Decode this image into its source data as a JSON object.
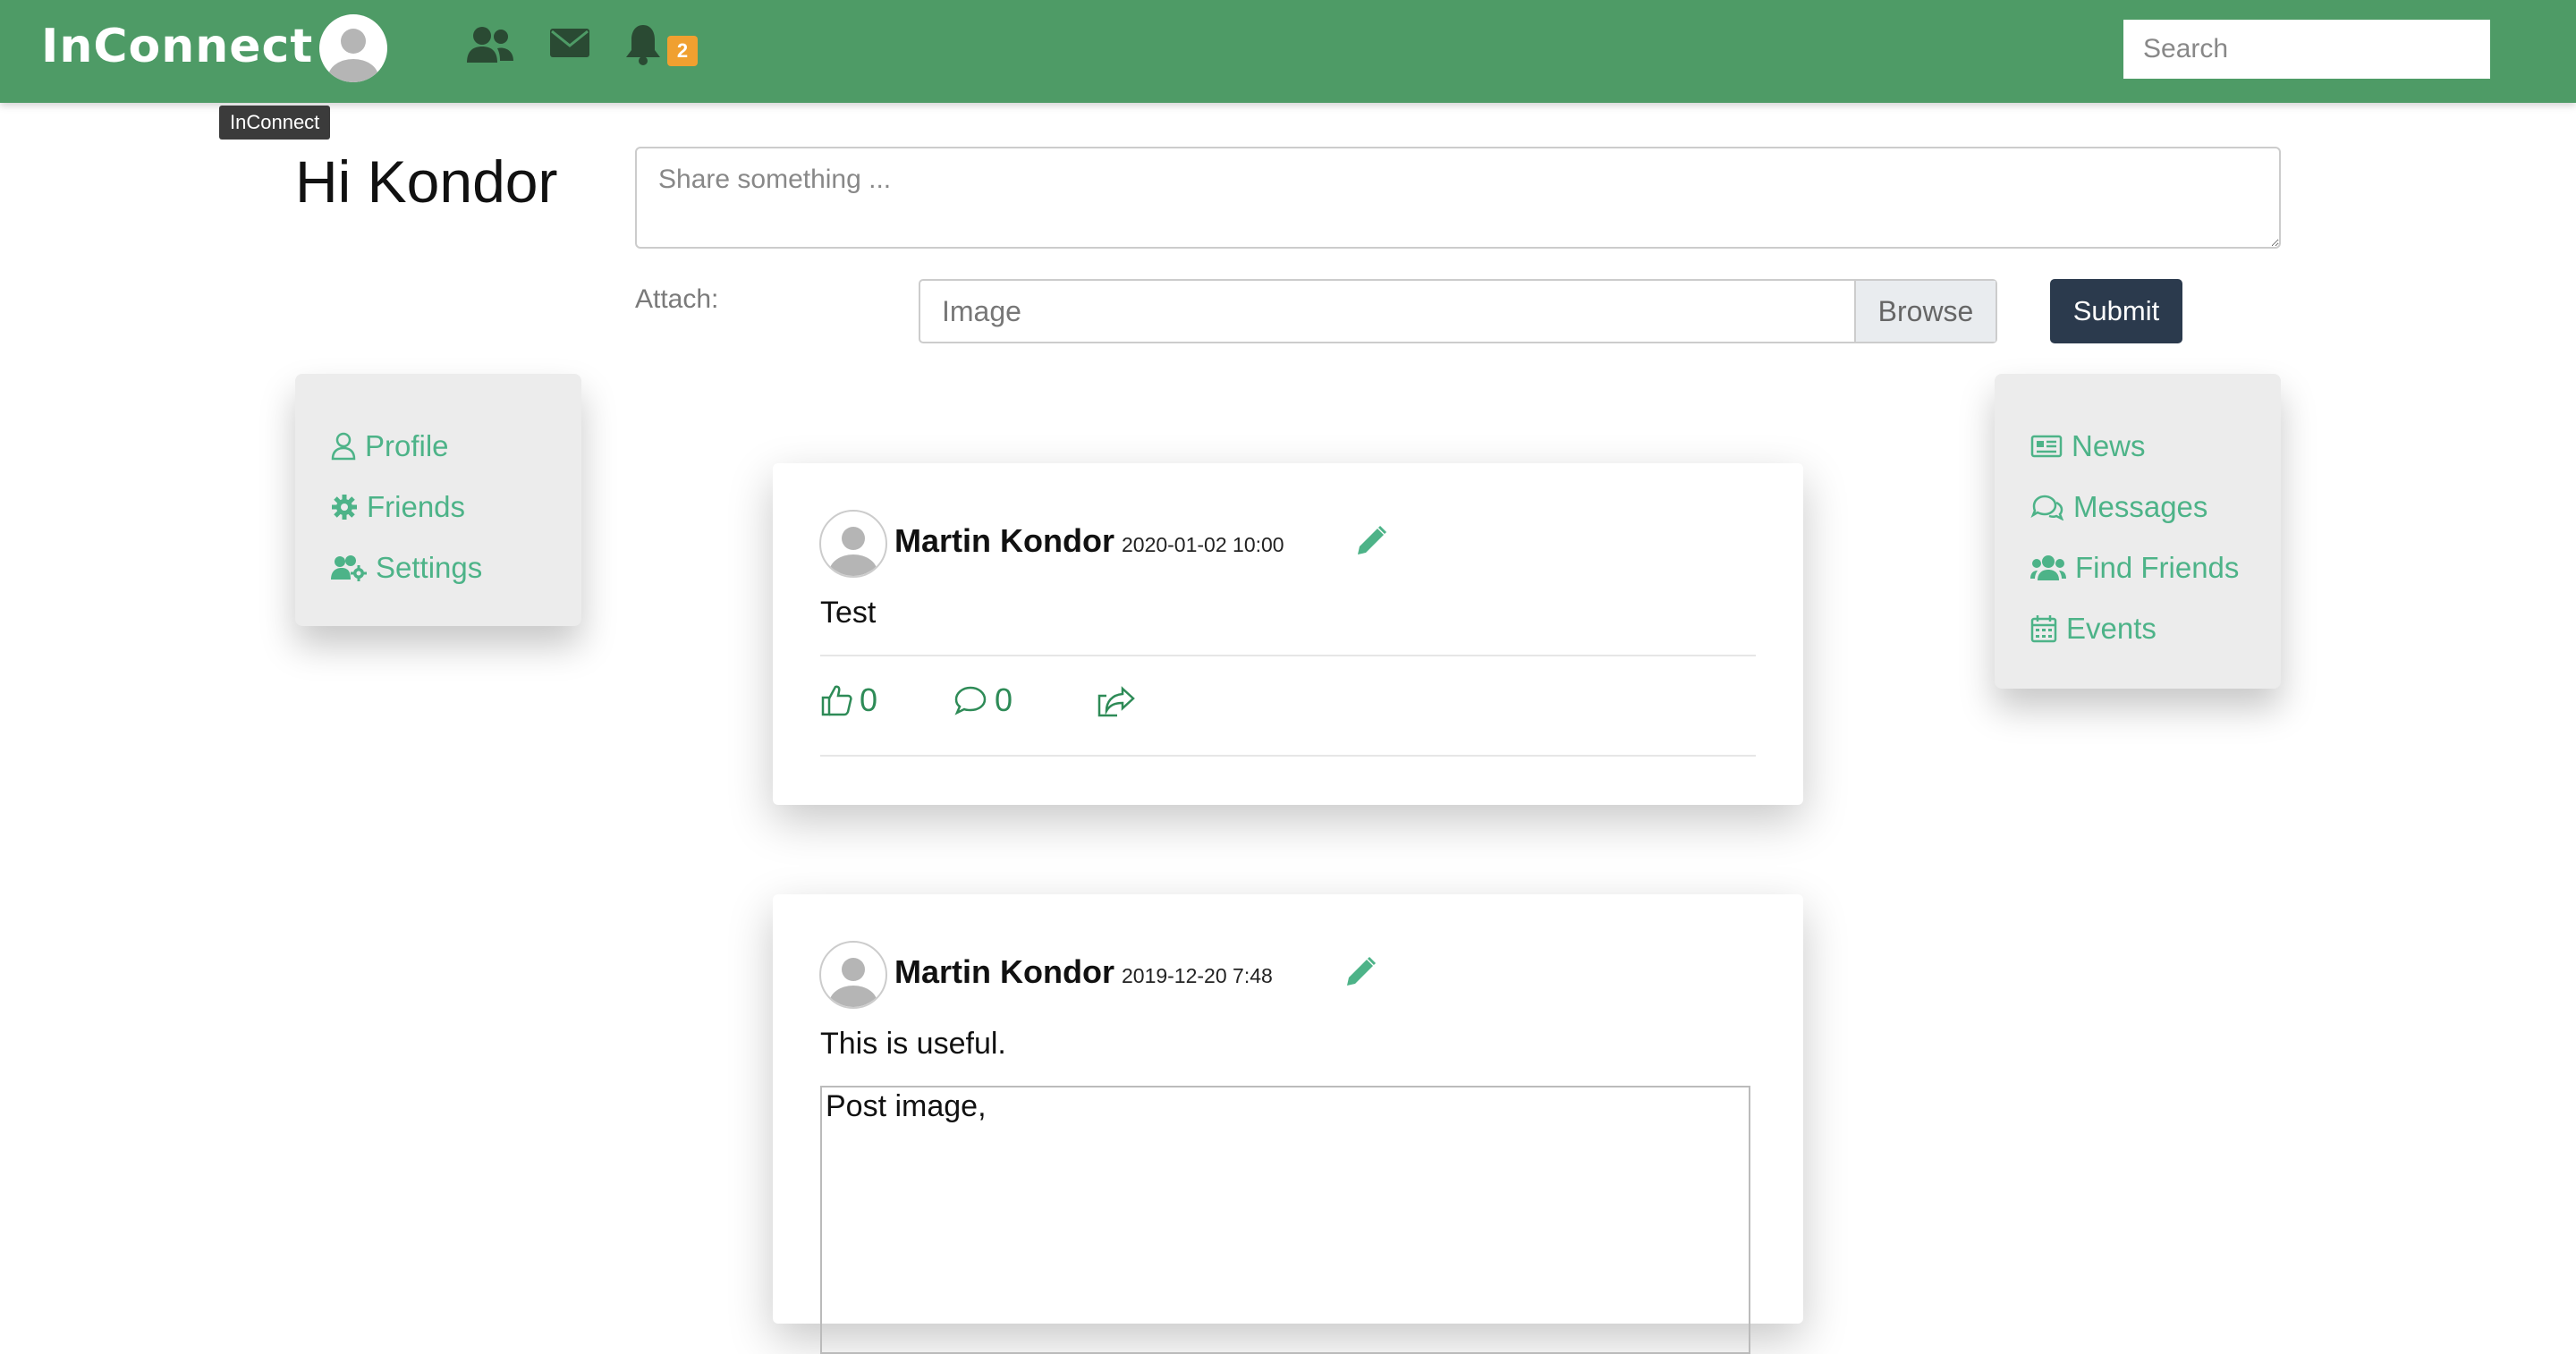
{
  "app": {
    "brand": "InConnect",
    "tooltip": "InConnect"
  },
  "nav": {
    "icons": [
      "users-icon",
      "envelope-icon",
      "bell-icon"
    ],
    "notification_count": "2",
    "search_placeholder": "Search"
  },
  "composer": {
    "greeting": "Hi Kondor",
    "share_placeholder": "Share something ...",
    "attach_label": "Attach:",
    "file_placeholder": "Image",
    "browse_label": "Browse",
    "submit_label": "Submit"
  },
  "left_menu": [
    {
      "label": "Profile",
      "icon": "user-icon"
    },
    {
      "label": "Friends",
      "icon": "gear-icon"
    },
    {
      "label": "Settings",
      "icon": "users-cog-icon"
    }
  ],
  "right_menu": [
    {
      "label": "News",
      "icon": "newspaper-icon"
    },
    {
      "label": "Messages",
      "icon": "comments-icon"
    },
    {
      "label": "Find Friends",
      "icon": "users-icon"
    },
    {
      "label": "Events",
      "icon": "calendar-icon"
    }
  ],
  "posts": [
    {
      "author": "Martin Kondor",
      "date": "2020-01-02 10:00",
      "text": "Test",
      "likes": "0",
      "comments": "0"
    },
    {
      "author": "Martin Kondor",
      "date": "2019-12-20 7:48",
      "text": "This is useful.",
      "image_alt": "Post image,"
    }
  ],
  "colors": {
    "topbar": "#4e9b66",
    "accent": "#4db388",
    "action": "#2e8b57",
    "submit": "#2b3a4d",
    "badge": "#f0a030"
  }
}
